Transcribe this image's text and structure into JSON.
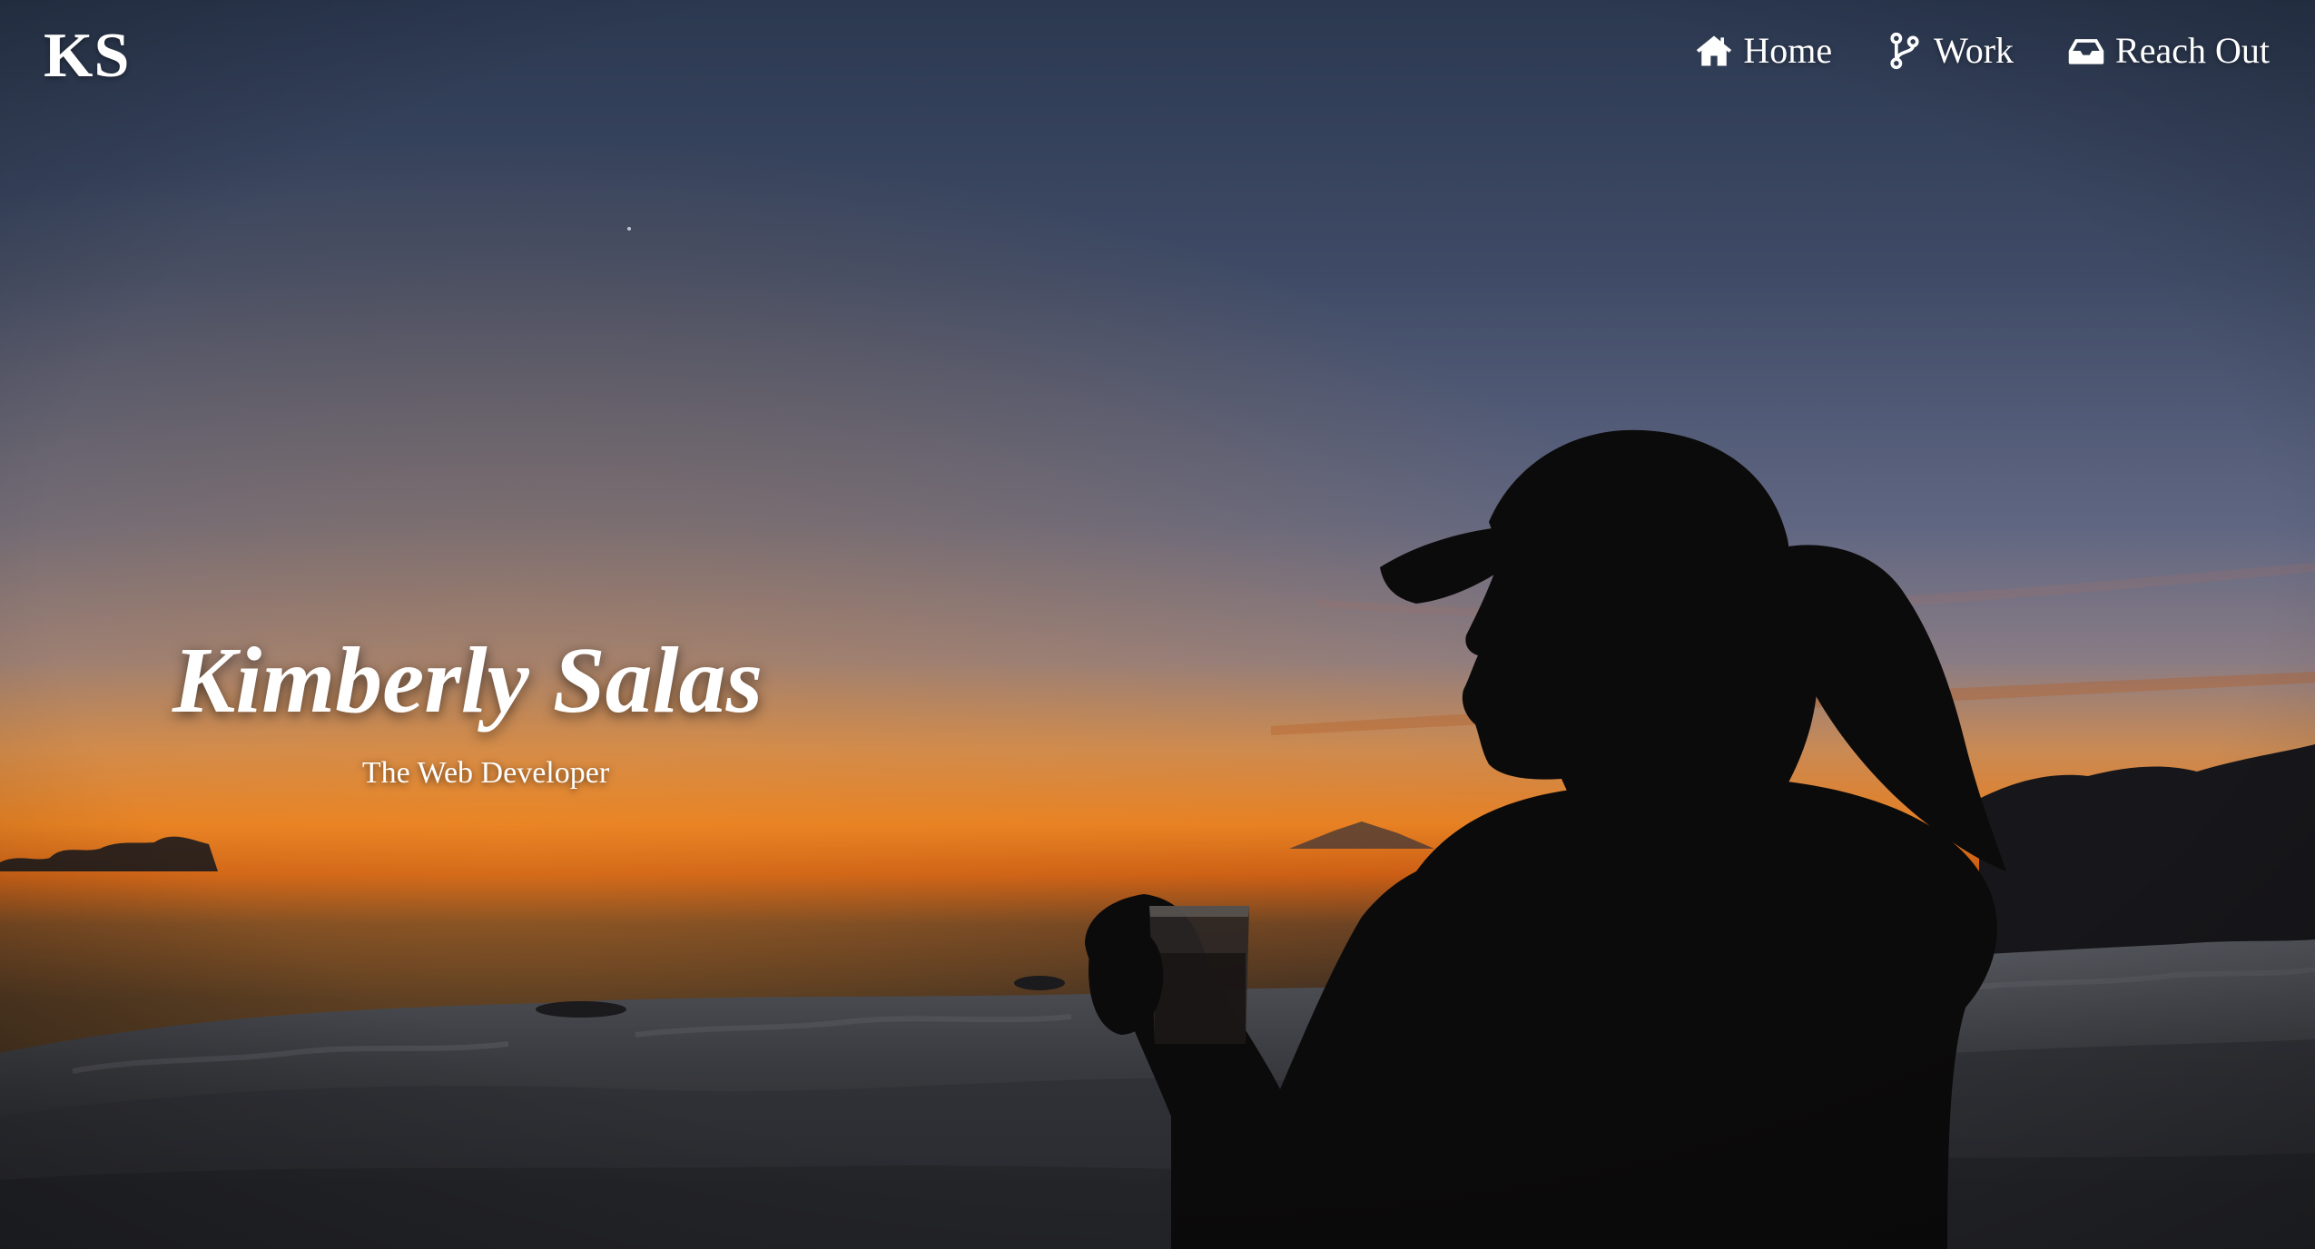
{
  "brand": {
    "logo_text": "KS"
  },
  "nav": {
    "items": [
      {
        "label": "Home",
        "icon": "home-icon"
      },
      {
        "label": "Work",
        "icon": "code-branch-icon"
      },
      {
        "label": "Reach Out",
        "icon": "inbox-icon"
      }
    ]
  },
  "hero": {
    "title": "Kimberly Salas",
    "subtitle": "The Web Developer",
    "background": "silhouette-sunset-above-clouds-photo"
  },
  "colors": {
    "text": "#ffffff",
    "sky_top": "#2d3a52",
    "horizon_orange": "#e2741c",
    "silhouette": "#0b0a0a"
  }
}
